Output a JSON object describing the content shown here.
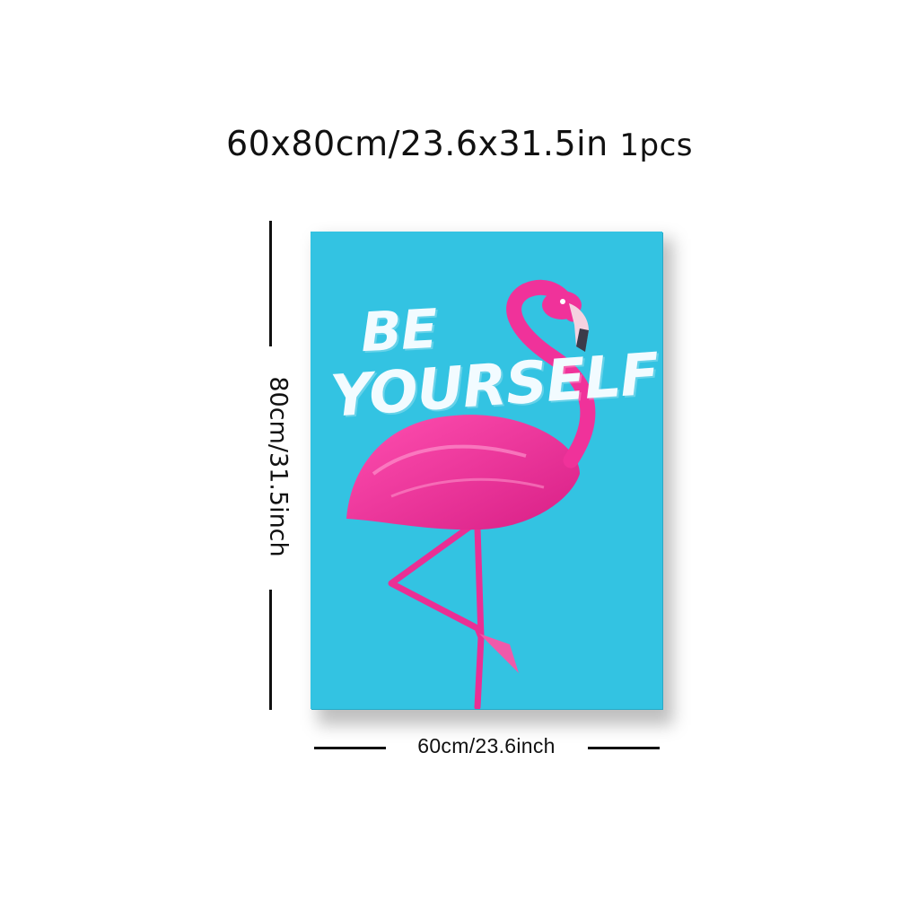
{
  "header": {
    "size_text": "60x80cm/23.6x31.5in",
    "quantity_text": "1pcs"
  },
  "dimensions": {
    "height_label": "80cm/31.5inch",
    "width_label": "60cm/23.6inch"
  },
  "poster": {
    "line_1": "BE",
    "line_2": "YOURSELF",
    "background_color": "#33c3e2",
    "flamingo_color": "#f0329a"
  }
}
